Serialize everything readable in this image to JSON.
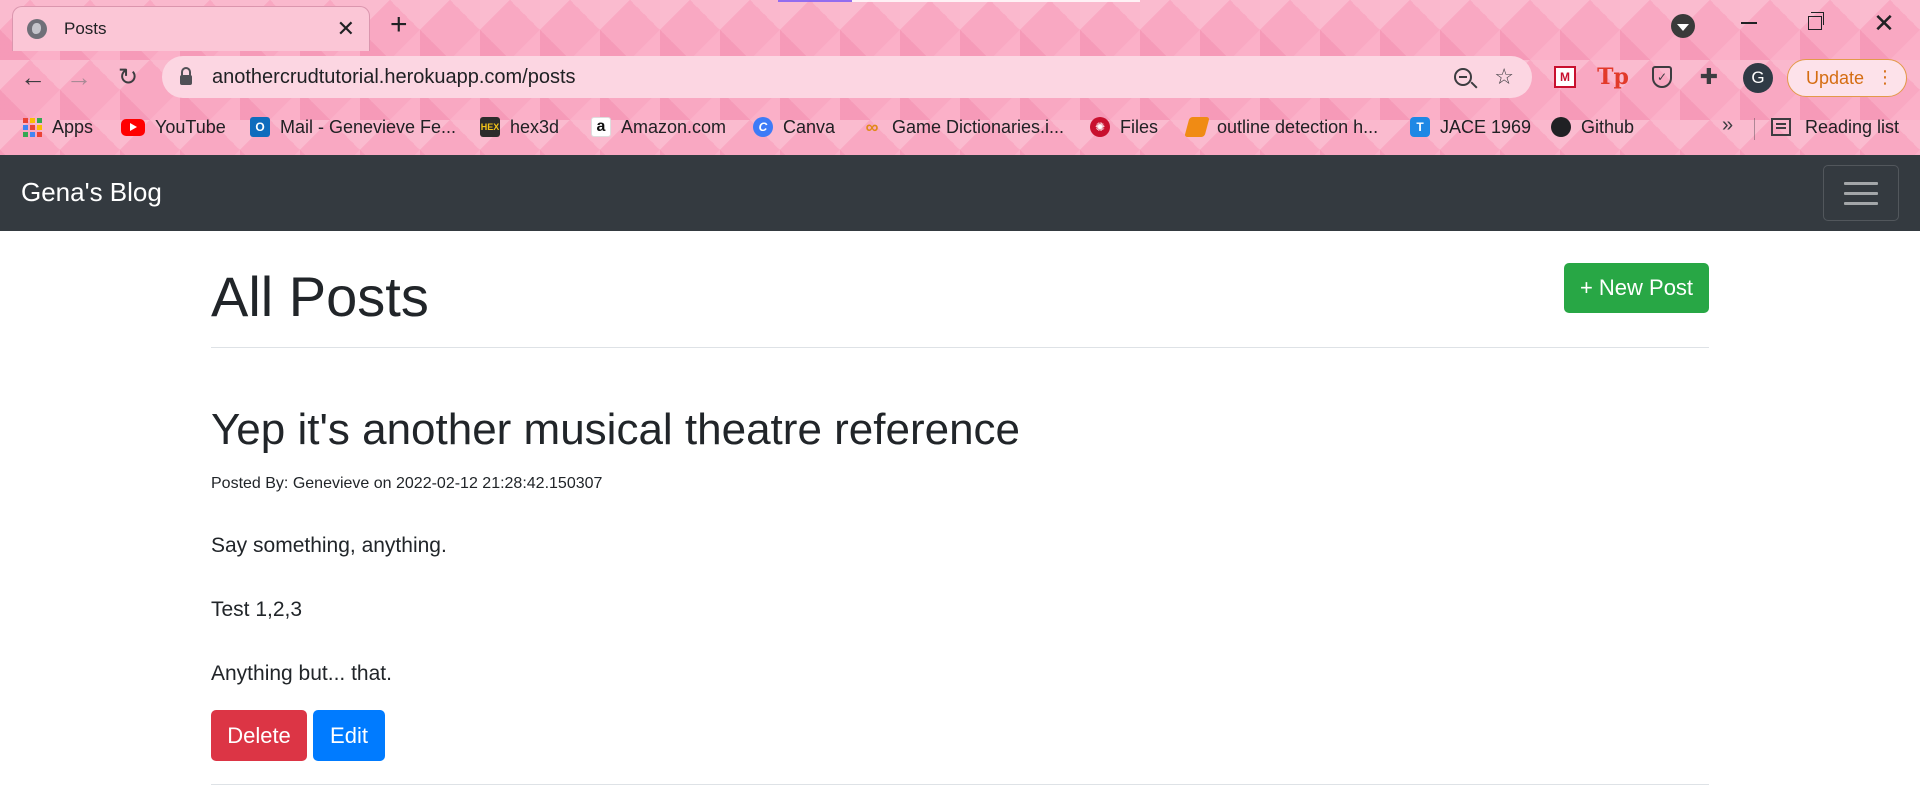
{
  "browser": {
    "tab": {
      "title": "Posts",
      "close_glyph": "✕",
      "icon": "globe-icon"
    },
    "new_tab_glyph": "+",
    "url": "anothercrudtutorial.herokuapp.com/posts",
    "update_label": "Update",
    "kebab_glyph": "⋮",
    "avatar_letter": "G",
    "nav_glyphs": {
      "back": "←",
      "forward": "→",
      "reload": "↻",
      "star": "☆",
      "close": "✕",
      "puzzle": "✚",
      "more": "»"
    },
    "ext_labels": {
      "tp": "Tp",
      "mcafee": "M",
      "shield": "✓"
    },
    "bookmarks": [
      {
        "label": "Apps",
        "icon": "apps-grid-icon"
      },
      {
        "label": "YouTube",
        "icon": "youtube-icon"
      },
      {
        "label": "Mail - Genevieve Fe...",
        "icon": "outlook-icon",
        "glyph": "O"
      },
      {
        "label": "hex3d",
        "icon": "hex3d-icon",
        "glyph": "HEX"
      },
      {
        "label": "Amazon.com",
        "icon": "amazon-icon",
        "glyph": "a"
      },
      {
        "label": "Canva",
        "icon": "canva-icon",
        "glyph": "C"
      },
      {
        "label": "Game Dictionaries.i...",
        "icon": "game-dictionaries-icon",
        "glyph": "∞"
      },
      {
        "label": "Files",
        "icon": "files-icon",
        "glyph": "✺"
      },
      {
        "label": "outline detection h...",
        "icon": "outline-detection-icon",
        "glyph": ""
      },
      {
        "label": "JACE 1969",
        "icon": "jace-icon",
        "glyph": "T"
      },
      {
        "label": "Github",
        "icon": "github-icon",
        "glyph": "●"
      }
    ],
    "reading_list": "Reading list"
  },
  "site": {
    "brand": "Gena's Blog",
    "page_title": "All Posts",
    "new_post_label": "+ New Post"
  },
  "posts": [
    {
      "title": "Yep it's another musical theatre reference",
      "meta": "Posted By: Genevieve on 2022-02-12 21:28:42.150307",
      "body": [
        "Say something, anything.",
        "Test 1,2,3",
        "Anything but... that."
      ],
      "delete_label": "Delete",
      "edit_label": "Edit"
    }
  ],
  "colors": {
    "navbar": "#343a40",
    "success": "#28a745",
    "danger": "#dc3545",
    "primary": "#007bff",
    "update_accent": "#d56d12"
  }
}
